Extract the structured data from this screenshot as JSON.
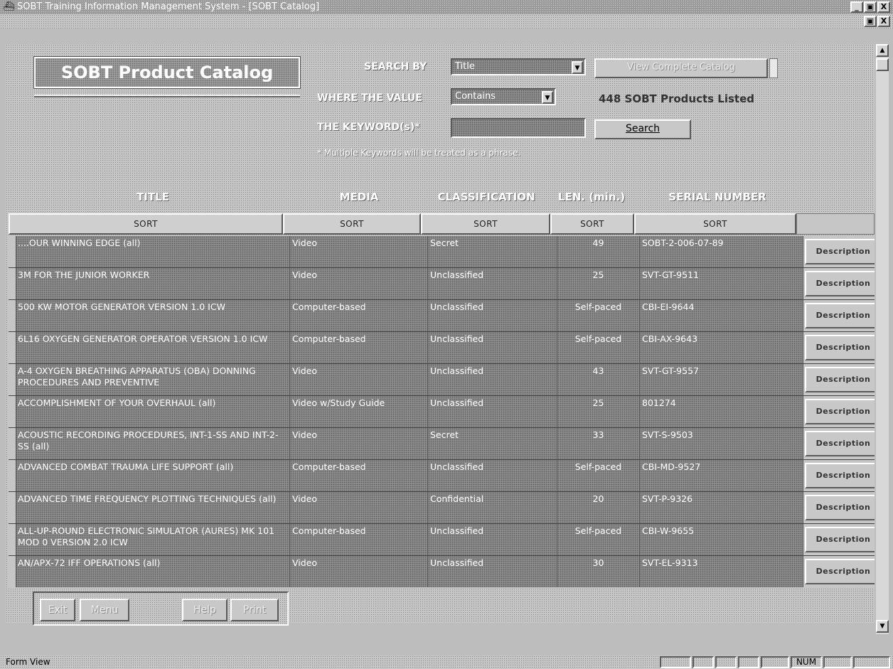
{
  "window": {
    "title": "SOBT Training Information Management System - [SOBT Catalog]",
    "controls": {
      "minimize": "_",
      "restore": "🗗",
      "close": "X"
    }
  },
  "form": {
    "heading": "SOBT Product Catalog",
    "search": {
      "search_by_label": "SEARCH BY",
      "search_by_value": "Title",
      "where_label": "WHERE THE VALUE",
      "where_value": "Contains",
      "keyword_label": "THE KEYWORD(s)*",
      "keyword_value": "",
      "note": "* Multiple Keywords will be treated as a phrase.",
      "search_button": "Search",
      "view_catalog_button": "View Complete Catalog",
      "products_count": "448 SOBT Products Listed"
    },
    "columns": {
      "title": "TITLE",
      "media": "MEDIA",
      "classification": "CLASSIFICATION",
      "length": "LEN. (min.)",
      "serial": "SERIAL NUMBER",
      "sort_label": "SORT"
    },
    "description_button": "Description",
    "rows": [
      {
        "title": "....OUR WINNING EDGE (all)",
        "media": "Video",
        "classification": "Secret",
        "length": "49",
        "serial": "SOBT-2-006-07-89"
      },
      {
        "title": "3M FOR THE JUNIOR WORKER",
        "media": "Video",
        "classification": "Unclassified",
        "length": "25",
        "serial": "SVT-GT-9511"
      },
      {
        "title": "500 KW MOTOR GENERATOR VERSION 1.0 ICW",
        "media": "Computer-based",
        "classification": "Unclassified",
        "length": "Self-paced",
        "serial": "CBI-EI-9644"
      },
      {
        "title": "6L16 OXYGEN GENERATOR OPERATOR VERSION 1.0 ICW",
        "media": "Computer-based",
        "classification": "Unclassified",
        "length": "Self-paced",
        "serial": "CBI-AX-9643"
      },
      {
        "title": "A-4 OXYGEN BREATHING APPARATUS (OBA) DONNING PROCEDURES AND PREVENTIVE",
        "media": "Video",
        "classification": "Unclassified",
        "length": "43",
        "serial": "SVT-GT-9557"
      },
      {
        "title": "ACCOMPLISHMENT OF YOUR OVERHAUL (all)",
        "media": "Video w/Study Guide",
        "classification": "Unclassified",
        "length": "25",
        "serial": "801274"
      },
      {
        "title": "ACOUSTIC RECORDING PROCEDURES, INT-1-SS AND INT-2-SS (all)",
        "media": "Video",
        "classification": "Secret",
        "length": "33",
        "serial": "SVT-S-9503"
      },
      {
        "title": "ADVANCED COMBAT TRAUMA LIFE SUPPORT (all)",
        "media": "Computer-based",
        "classification": "Unclassified",
        "length": "Self-paced",
        "serial": "CBI-MD-9527"
      },
      {
        "title": "ADVANCED TIME FREQUENCY PLOTTING TECHNIQUES (all)",
        "media": "Video",
        "classification": "Confidential",
        "length": "20",
        "serial": "SVT-P-9326"
      },
      {
        "title": "ALL-UP-ROUND ELECTRONIC SIMULATOR (AURES) MK 101 MOD 0 VERSION 2.0 ICW",
        "media": "Computer-based",
        "classification": "Unclassified",
        "length": "Self-paced",
        "serial": "CBI-W-9655"
      },
      {
        "title": "AN/APX-72 IFF OPERATIONS (all)",
        "media": "Video",
        "classification": "Unclassified",
        "length": "30",
        "serial": "SVT-EL-9313"
      }
    ],
    "footer_buttons": {
      "exit": "Exit",
      "menu": "Menu",
      "help": "Help",
      "print": "Print"
    }
  },
  "statusbar": {
    "text": "Form View",
    "num": "NUM"
  }
}
